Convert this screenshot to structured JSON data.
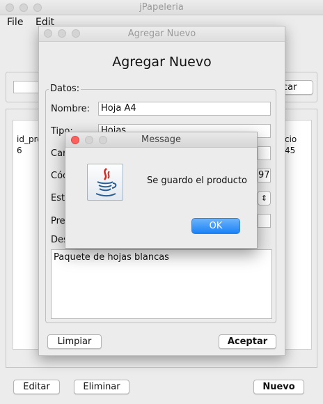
{
  "main": {
    "title": "jPapeleria",
    "menu": [
      "File",
      "Edit"
    ],
    "search_button_partial": "car",
    "table": {
      "col1_header": "id_pro",
      "col1_value": "6",
      "col_last_header": "cio",
      "col_last_value": "45"
    },
    "buttons": {
      "editar": "Editar",
      "eliminar": "Eliminar",
      "nuevo": "Nuevo"
    }
  },
  "dialog": {
    "title": "Agregar Nuevo",
    "heading": "Agregar Nuevo",
    "group_label": "Datos:",
    "labels": {
      "nombre": "Nombre:",
      "tipo": "Tipo:",
      "cantidad_partial": "Car",
      "codigo_partial": "Cóc",
      "estado_partial": "Est",
      "precio_partial": "Pre",
      "descripcion_partial": "Des"
    },
    "values": {
      "nombre": "Hoja A4",
      "tipo": "Hojas",
      "codigo_tail": "97"
    },
    "descripcion": "Paquete de hojas blancas",
    "buttons": {
      "limpiar": "Limpiar",
      "aceptar": "Aceptar"
    }
  },
  "message": {
    "title": "Message",
    "text": "Se guardo el producto",
    "ok": "OK"
  },
  "colors": {
    "close_red": "#fc605c",
    "ok_blue": "#1a82f7"
  }
}
